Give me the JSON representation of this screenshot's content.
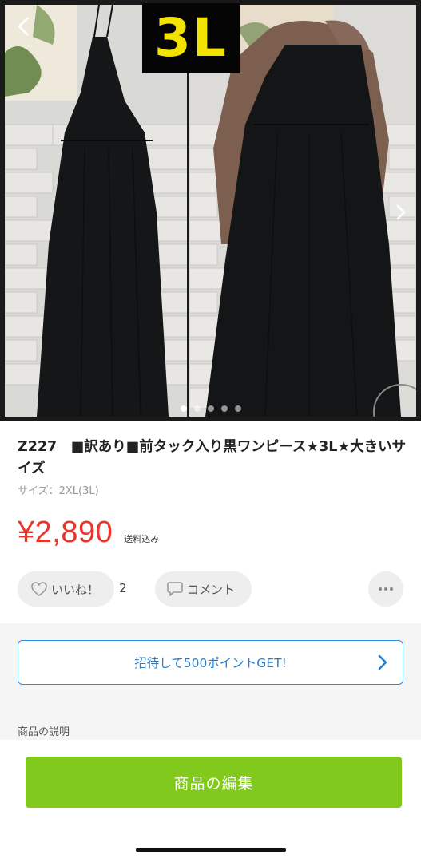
{
  "photo": {
    "size_badge": "3L",
    "back_icon": "chevron-left-icon",
    "next_icon": "chevron-right-icon",
    "dot_count": 5,
    "active_dot": 1
  },
  "item": {
    "title": "Z227　■訳あり■前タック入り黒ワンピース★3L★大きいサイズ",
    "size": "サイズ：2XL(3L)",
    "price": "¥2,890",
    "shipping": "送料込み"
  },
  "actions": {
    "like_label": "いいね！",
    "like_count": "2",
    "comment_label": "コメント",
    "more_icon": "more-horizontal-icon"
  },
  "invite": {
    "label": "招待して500ポイントGET!"
  },
  "description": {
    "heading": "商品の説明"
  },
  "footer": {
    "edit_button": "商品の編集"
  },
  "colors": {
    "price": "#ea352d",
    "accent_blue": "#2a8ee8",
    "edit_green": "#82c91e",
    "badge_yellow": "#f2e400"
  }
}
